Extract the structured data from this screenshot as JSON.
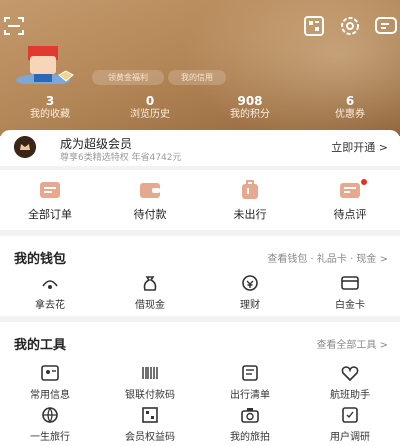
{
  "header": {
    "pill_left": "领黄金福利",
    "pill_right": "我的信用",
    "stats": [
      {
        "value": "3",
        "label": "我的收藏"
      },
      {
        "value": "0",
        "label": "浏览历史"
      },
      {
        "value": "908",
        "label": "我的积分"
      },
      {
        "value": "6",
        "label": "优惠券"
      }
    ]
  },
  "member": {
    "title": "成为超级会员",
    "subtitle": "尊享6类精选特权 年省4742元",
    "action": "立即开通 >"
  },
  "orders": [
    {
      "label": "全部订单"
    },
    {
      "label": "待付款"
    },
    {
      "label": "未出行"
    },
    {
      "label": "待点评"
    }
  ],
  "wallet": {
    "title": "我的钱包",
    "link": "查看钱包 · 礼品卡 · 现金 >",
    "items": [
      {
        "label": "拿去花"
      },
      {
        "label": "借现金"
      },
      {
        "label": "理财"
      },
      {
        "label": "白金卡"
      }
    ]
  },
  "tools": {
    "title": "我的工具",
    "link": "查看全部工具 >",
    "items": [
      {
        "label": "常用信息"
      },
      {
        "label": "银联付款码"
      },
      {
        "label": "出行清单"
      },
      {
        "label": "航班助手"
      },
      {
        "label": "一生旅行"
      },
      {
        "label": "会员权益码"
      },
      {
        "label": "我的旅拍"
      },
      {
        "label": "用户调研"
      }
    ]
  },
  "colors": {
    "header_gold": "#b38657",
    "accent_red": "#e0321f"
  }
}
